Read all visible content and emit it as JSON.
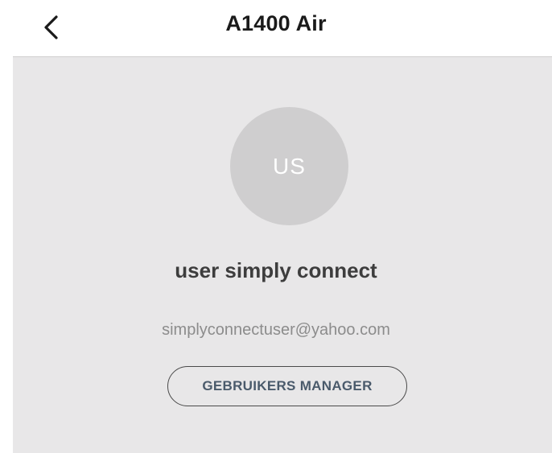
{
  "header": {
    "title": "A1400 Air",
    "back_icon": "chevron-left-icon"
  },
  "profile": {
    "avatar_initials": "US",
    "name": "user simply connect",
    "email": "simplyconnectuser@yahoo.com",
    "manager_button_label": "GEBRUIKERS MANAGER"
  },
  "colors": {
    "card_background": "#e8e7e8",
    "avatar_background": "#cfcecf",
    "button_text": "#4a5a6b",
    "name_text": "#3d3d3d",
    "email_text": "#8c8c8c"
  }
}
